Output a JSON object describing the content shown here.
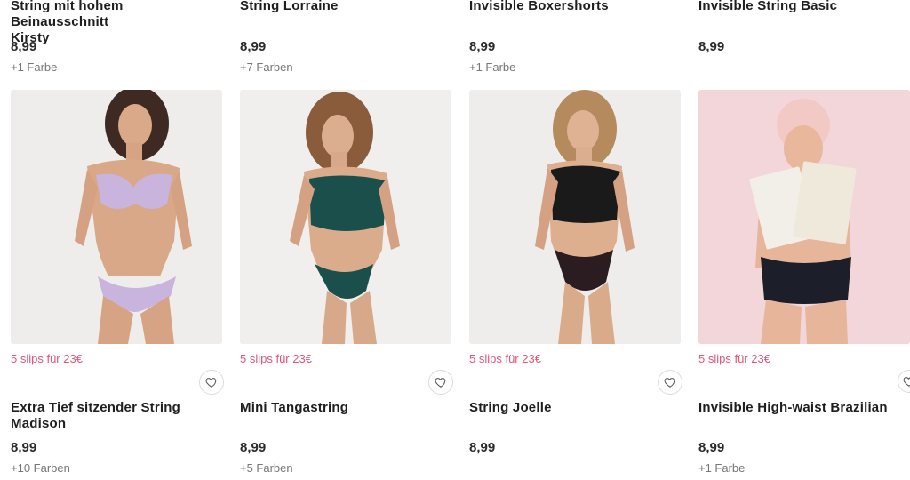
{
  "top_row": [
    {
      "title_line1": "String mit hohem Beinausschnitt",
      "title_line2": "Kirsty",
      "price": "8,99",
      "colors": "+1 Farbe"
    },
    {
      "title_line1": "String Lorraine",
      "title_line2": "",
      "price": "8,99",
      "colors": "+7 Farben"
    },
    {
      "title_line1": "Invisible Boxershorts",
      "title_line2": "",
      "price": "8,99",
      "colors": "+1 Farbe"
    },
    {
      "title_line1": "Invisible String Basic",
      "title_line2": "",
      "price": "8,99",
      "colors": ""
    }
  ],
  "bottom_row": [
    {
      "promo": "5 slips für 23€",
      "title_line1": "Extra Tief sitzender String",
      "title_line2": "Madison",
      "price": "8,99",
      "colors": "+10 Farben"
    },
    {
      "promo": "5 slips für 23€",
      "title_line1": "Mini Tangastring",
      "title_line2": "",
      "price": "8,99",
      "colors": "+5 Farben"
    },
    {
      "promo": "5 slips für 23€",
      "title_line1": "String Joelle",
      "title_line2": "",
      "price": "8,99",
      "colors": ""
    },
    {
      "promo": "5 slips für 23€",
      "title_line1": "Invisible High-waist Brazilian",
      "title_line2": "",
      "price": "8,99",
      "colors": "+1 Farbe"
    }
  ],
  "wishlist_icon": "heart-icon",
  "colors": {
    "promo": "#e0557a",
    "muted": "#777777"
  }
}
